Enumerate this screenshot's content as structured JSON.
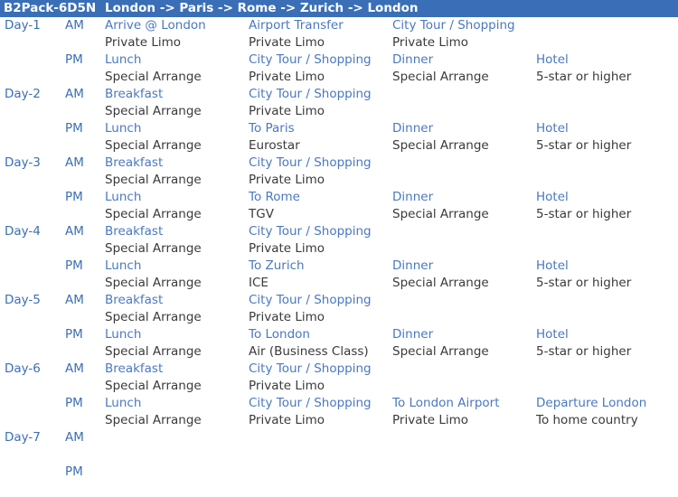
{
  "header": {
    "code": "B2Pack-6D5N",
    "route": "London -> Paris -> Rome -> Zurich -> London"
  },
  "rows": [
    {
      "day": "Day-1",
      "period": "AM",
      "type": "act",
      "cells": [
        "Arrive @ London",
        "Airport Transfer",
        "City Tour / Shopping",
        ""
      ]
    },
    {
      "day": "",
      "period": "",
      "type": "det",
      "cells": [
        "Private Limo",
        "Private Limo",
        "Private Limo",
        ""
      ]
    },
    {
      "day": "",
      "period": "PM",
      "type": "act",
      "cells": [
        "Lunch",
        "City Tour / Shopping",
        "Dinner",
        "Hotel"
      ]
    },
    {
      "day": "",
      "period": "",
      "type": "det",
      "cells": [
        "Special Arrange",
        "Private Limo",
        "Special Arrange",
        "5-star or higher"
      ]
    },
    {
      "day": "Day-2",
      "period": "AM",
      "type": "act",
      "cells": [
        "Breakfast",
        "City Tour / Shopping",
        "",
        ""
      ]
    },
    {
      "day": "",
      "period": "",
      "type": "det",
      "cells": [
        "Special Arrange",
        "Private Limo",
        "",
        ""
      ]
    },
    {
      "day": "",
      "period": "PM",
      "type": "act",
      "cells": [
        "Lunch",
        "To Paris",
        "Dinner",
        "Hotel"
      ]
    },
    {
      "day": "",
      "period": "",
      "type": "det",
      "cells": [
        "Special Arrange",
        "Eurostar",
        "Special Arrange",
        "5-star or higher"
      ]
    },
    {
      "day": "Day-3",
      "period": "AM",
      "type": "act",
      "cells": [
        "Breakfast",
        "City Tour / Shopping",
        "",
        ""
      ]
    },
    {
      "day": "",
      "period": "",
      "type": "det",
      "cells": [
        "Special Arrange",
        "Private Limo",
        "",
        ""
      ]
    },
    {
      "day": "",
      "period": "PM",
      "type": "act",
      "cells": [
        "Lunch",
        "To Rome",
        "Dinner",
        "Hotel"
      ]
    },
    {
      "day": "",
      "period": "",
      "type": "det",
      "cells": [
        "Special Arrange",
        "TGV",
        "Special Arrange",
        "5-star or higher"
      ]
    },
    {
      "day": "Day-4",
      "period": "AM",
      "type": "act",
      "cells": [
        "Breakfast",
        "City Tour / Shopping",
        "",
        ""
      ]
    },
    {
      "day": "",
      "period": "",
      "type": "det",
      "cells": [
        "Special Arrange",
        "Private Limo",
        "",
        ""
      ]
    },
    {
      "day": "",
      "period": "PM",
      "type": "act",
      "cells": [
        "Lunch",
        "To Zurich",
        "Dinner",
        "Hotel"
      ]
    },
    {
      "day": "",
      "period": "",
      "type": "det",
      "cells": [
        "Special Arrange",
        "ICE",
        "Special Arrange",
        "5-star or higher"
      ]
    },
    {
      "day": "Day-5",
      "period": "AM",
      "type": "act",
      "cells": [
        "Breakfast",
        "City Tour / Shopping",
        "",
        ""
      ]
    },
    {
      "day": "",
      "period": "",
      "type": "det",
      "cells": [
        "Special Arrange",
        "Private Limo",
        "",
        ""
      ]
    },
    {
      "day": "",
      "period": "PM",
      "type": "act",
      "cells": [
        "Lunch",
        "To London",
        "Dinner",
        "Hotel"
      ]
    },
    {
      "day": "",
      "period": "",
      "type": "det",
      "cells": [
        "Special Arrange",
        "Air (Business Class)",
        "Special Arrange",
        "5-star or higher"
      ]
    },
    {
      "day": "Day-6",
      "period": "AM",
      "type": "act",
      "cells": [
        "Breakfast",
        "City Tour / Shopping",
        "",
        ""
      ]
    },
    {
      "day": "",
      "period": "",
      "type": "det",
      "cells": [
        "Special Arrange",
        "Private Limo",
        "",
        ""
      ]
    },
    {
      "day": "",
      "period": "PM",
      "type": "act",
      "cells": [
        "Lunch",
        "City Tour / Shopping",
        "To London Airport",
        "Departure London"
      ]
    },
    {
      "day": "",
      "period": "",
      "type": "det",
      "cells": [
        "Special Arrange",
        "Private Limo",
        "Private Limo",
        "To home country"
      ]
    },
    {
      "day": "Day-7",
      "period": "AM",
      "type": "act",
      "cells": [
        "",
        "",
        "",
        ""
      ]
    },
    {
      "day": "",
      "period": "",
      "type": "det",
      "cells": [
        "",
        "",
        "",
        ""
      ]
    },
    {
      "day": "",
      "period": "PM",
      "type": "act",
      "cells": [
        "",
        "",
        "",
        ""
      ]
    }
  ]
}
